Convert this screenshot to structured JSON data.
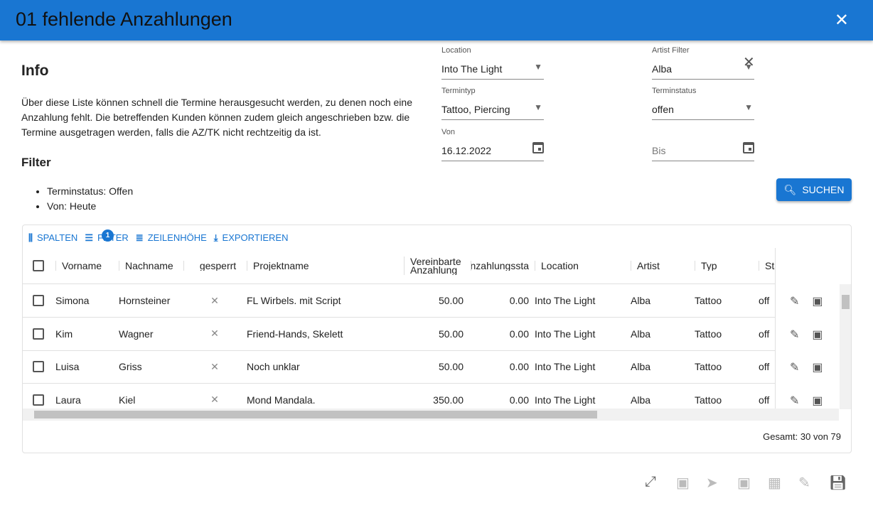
{
  "dialog": {
    "title": "01 fehlende Anzahlungen"
  },
  "info": {
    "heading": "Info",
    "description": "Über diese Liste können schnell die Termine herausgesucht werden, zu denen noch eine Anzahlung fehlt. Die betreffenden Kunden können zudem gleich angeschrieben bzw. die Termine ausgetragen werden, falls die AZ/TK nicht rechtzeitig da ist.",
    "filter_heading": "Filter",
    "filters": [
      "Terminstatus: Offen",
      "Von: Heute"
    ]
  },
  "form": {
    "location_label": "Location",
    "location": "Into The Light",
    "artist_label": "Artist Filter",
    "artist": "Alba",
    "termintyp_label": "Termintyp",
    "termintyp": "Tattoo, Piercing",
    "status_label": "Terminstatus",
    "status": "offen",
    "von_label": "Von",
    "von": "16.12.2022",
    "bis_placeholder": "Bis",
    "search": "SUCHEN"
  },
  "toolbar": {
    "columns": "SPALTEN",
    "filter": "FILTER",
    "filter_count": "1",
    "density": "ZEILENHÖHE",
    "export": "EXPORTIEREN"
  },
  "columns": [
    "Vorname",
    "Nachname",
    "gesperrt",
    "Projektname",
    "Vereinbarte Anzahlung",
    "Anzahlungssta",
    "Location",
    "Artist",
    "Typ",
    "Sta"
  ],
  "rows": [
    [
      "Simona",
      "Hornsteiner",
      "✕",
      "FL Wirbels. mit Script",
      "50.00",
      "0.00",
      "Into The Light",
      "Alba",
      "Tattoo",
      "off"
    ],
    [
      "Kim",
      "Wagner",
      "✕",
      "Friend-Hands, Skelett",
      "50.00",
      "0.00",
      "Into The Light",
      "Alba",
      "Tattoo",
      "off"
    ],
    [
      "Luisa",
      "Griss",
      "✕",
      "Noch unklar",
      "50.00",
      "0.00",
      "Into The Light",
      "Alba",
      "Tattoo",
      "off"
    ],
    [
      "Laura",
      "Kiel",
      "✕",
      "Mond Mandala.",
      "350.00",
      "0.00",
      "Into The Light",
      "Alba",
      "Tattoo",
      "off"
    ]
  ],
  "footer": {
    "total": "Gesamt: 30 von 79"
  }
}
